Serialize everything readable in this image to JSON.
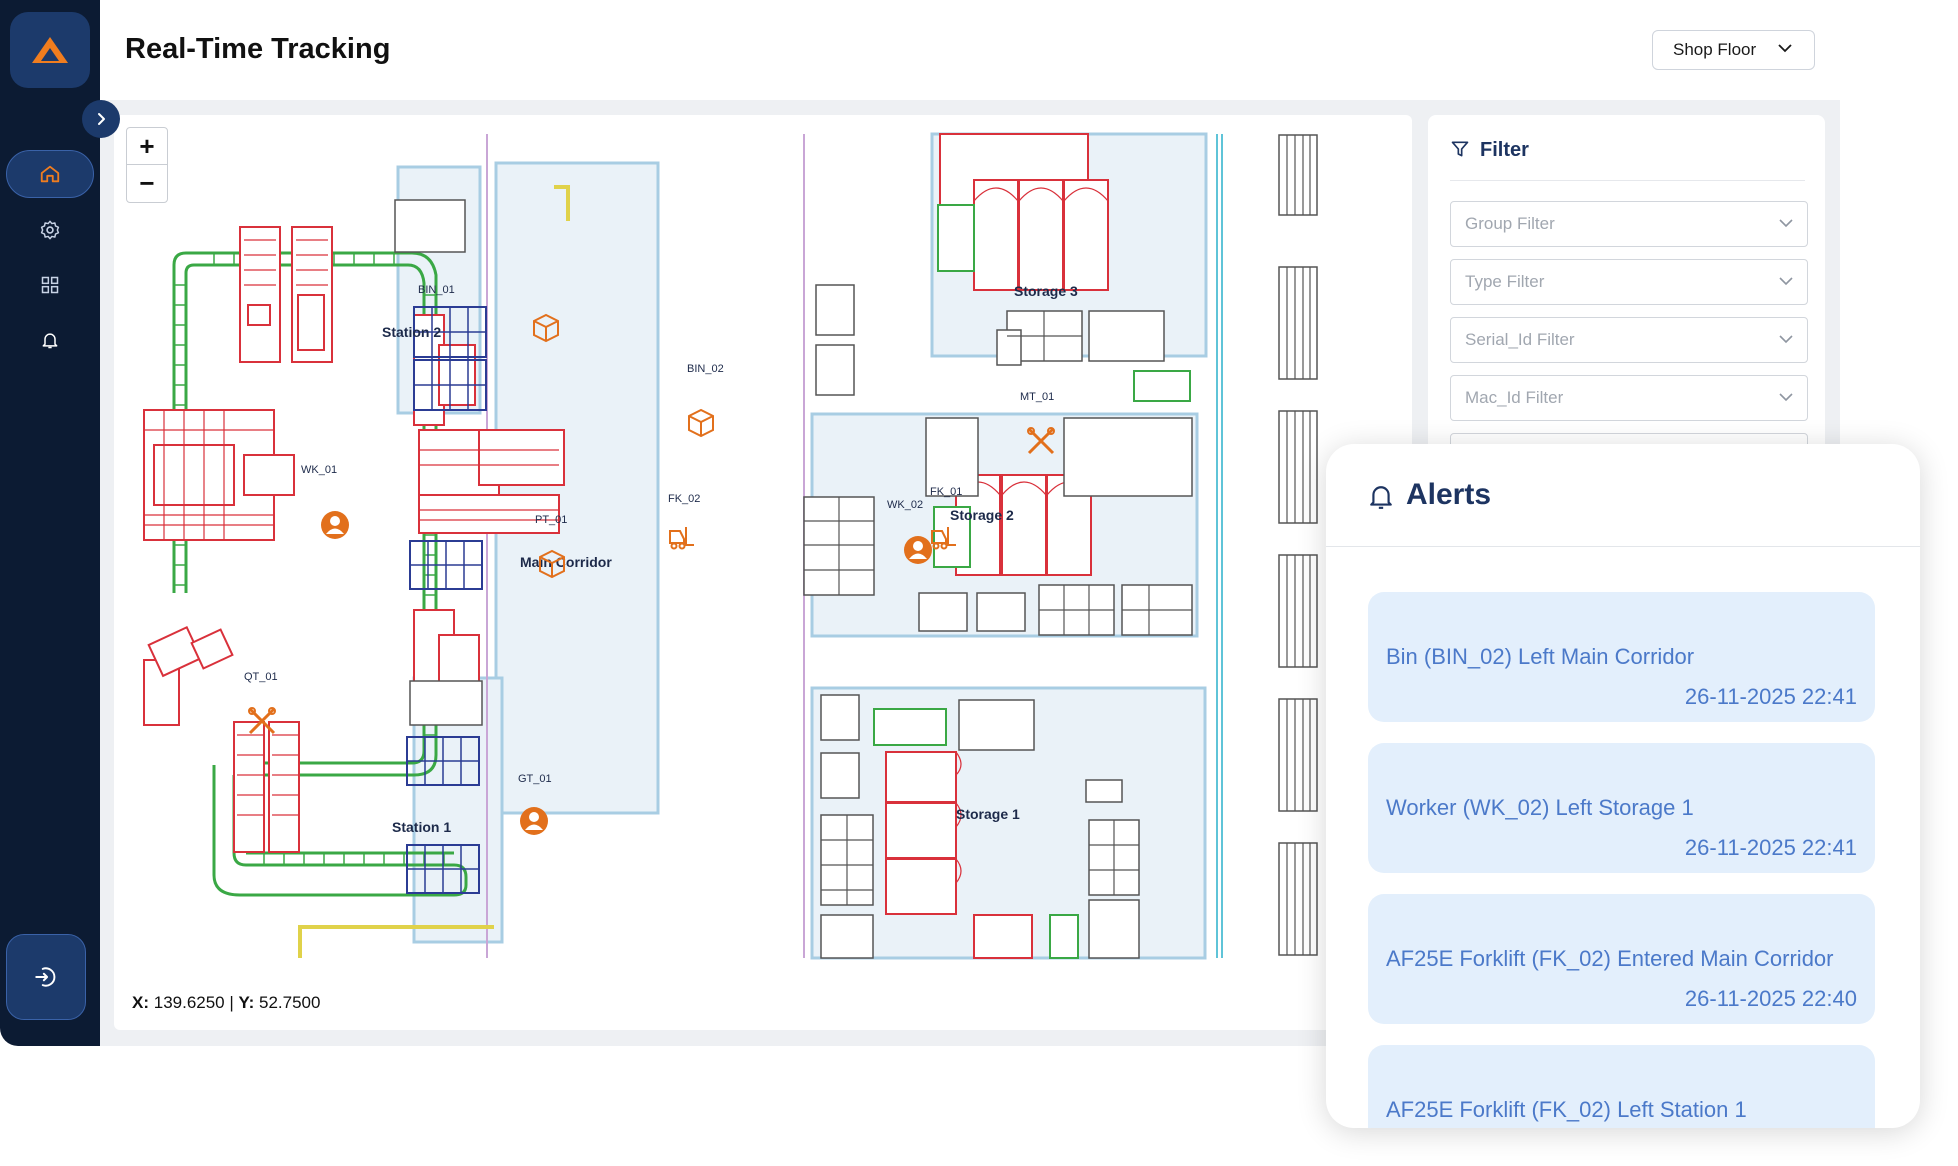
{
  "header": {
    "title": "Real-Time Tracking",
    "location_select": {
      "value": "Shop Floor"
    }
  },
  "sidebar": {
    "items": [
      {
        "icon": "home-icon",
        "active": true
      },
      {
        "icon": "gear-icon",
        "active": false
      },
      {
        "icon": "grid-icon",
        "active": false
      },
      {
        "icon": "bell-icon",
        "active": false
      }
    ],
    "logout_icon": "logout-icon"
  },
  "map": {
    "zoom_in_label": "+",
    "zoom_out_label": "−",
    "coords": {
      "x_label": "X:",
      "x_value": "139.6250",
      "separator": "|",
      "y_label": "Y:",
      "y_value": "52.7500"
    },
    "areas": {
      "station2": "Station 2",
      "station1": "Station 1",
      "main_corridor": "Main Corridor",
      "storage3": "Storage 3",
      "storage2": "Storage 2",
      "storage1": "Storage 1"
    },
    "assets": {
      "bin01": "BIN_01",
      "bin02": "BIN_02",
      "fk02": "FK_02",
      "fk01": "FK_01",
      "mt01": "MT_01",
      "wk01": "WK_01",
      "wk02": "WK_02",
      "pt01": "PT_01",
      "qt01": "QT_01",
      "gt01": "GT_01"
    },
    "colors": {
      "zone": "#a8cde3",
      "conveyor": "#3aa845",
      "machine": "#d9313b",
      "rack": "#2b3c94",
      "marker": "#e2701c"
    }
  },
  "filter": {
    "title": "Filter",
    "fields": [
      {
        "placeholder": "Group Filter"
      },
      {
        "placeholder": "Type Filter"
      },
      {
        "placeholder": "Serial_Id Filter"
      },
      {
        "placeholder": "Mac_Id Filter"
      }
    ]
  },
  "alerts": {
    "title": "Alerts",
    "items": [
      {
        "message": "Bin (BIN_02) Left Main Corridor",
        "time": "26-11-2025 22:41"
      },
      {
        "message": "Worker (WK_02) Left Storage 1",
        "time": "26-11-2025 22:41"
      },
      {
        "message": "AF25E Forklift (FK_02) Entered Main Corridor",
        "time": "26-11-2025 22:40"
      },
      {
        "message": "AF25E Forklift (FK_02) Left Station 1",
        "time": ""
      }
    ]
  }
}
